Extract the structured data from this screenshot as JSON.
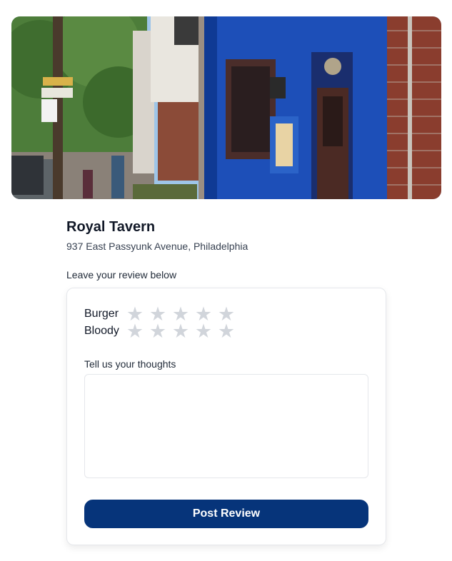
{
  "restaurant": {
    "name": "Royal Tavern",
    "address": "937 East Passyunk Avenue, Philadelphia"
  },
  "review_prompt": "Leave your review below",
  "ratings": [
    {
      "label": "Burger",
      "max_stars": 5,
      "selected": 0
    },
    {
      "label": "Bloody",
      "max_stars": 5,
      "selected": 0
    }
  ],
  "thoughts": {
    "label": "Tell us your thoughts",
    "value": "",
    "placeholder": ""
  },
  "submit_label": "Post Review",
  "colors": {
    "accent": "#06347a",
    "star_empty": "#d1d5db",
    "border": "#e5e7eb"
  }
}
